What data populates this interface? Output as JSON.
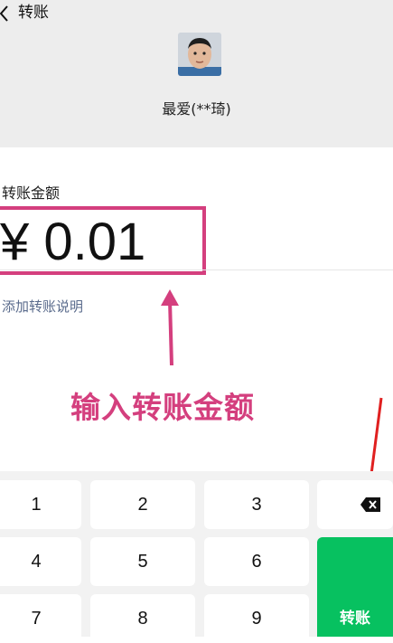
{
  "header": {
    "title": "转账",
    "payee_name": "最爱(**琦)"
  },
  "amount": {
    "label": "转账金额",
    "value": "¥ 0.01"
  },
  "note": {
    "add_label": "添加转账说明"
  },
  "annotation": {
    "text": "输入转账金额",
    "color": "#d43f7e"
  },
  "keypad": {
    "keys": [
      "1",
      "2",
      "3",
      "4",
      "5",
      "6",
      "7",
      "8",
      "9"
    ],
    "transfer_label": "转账"
  },
  "colors": {
    "header_bg": "#ededed",
    "primary_button": "#07c160",
    "annotation_red_arrow": "#e02020"
  }
}
